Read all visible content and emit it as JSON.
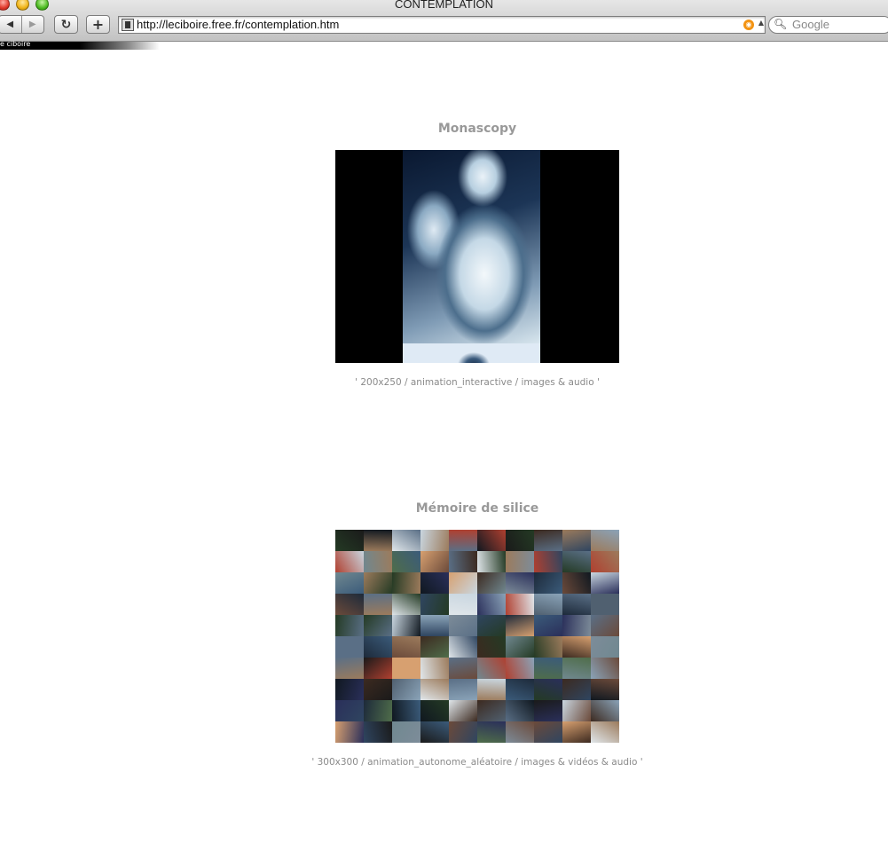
{
  "window": {
    "title": "CONTEMPLATION"
  },
  "toolbar": {
    "back_icon": "back-arrow-icon",
    "forward_icon": "forward-arrow-icon",
    "reload_icon": "reload-icon",
    "add_icon": "plus-icon",
    "url": "http://leciboire.free.fr/contemplation.htm",
    "search_placeholder": "Google"
  },
  "tab": {
    "label": "e ciboire"
  },
  "works": [
    {
      "title": "Monascopy",
      "caption": "' 200x250 / animation_interactive / images & audio '"
    },
    {
      "title": "Mémoire de silice",
      "caption": "' 300x300 / animation_autonome_aléatoire / images & vidéos & audio '"
    }
  ],
  "colors": {
    "title_gray": "#999999",
    "caption_gray": "#8a8a8a",
    "rss_orange": "#f39312"
  }
}
